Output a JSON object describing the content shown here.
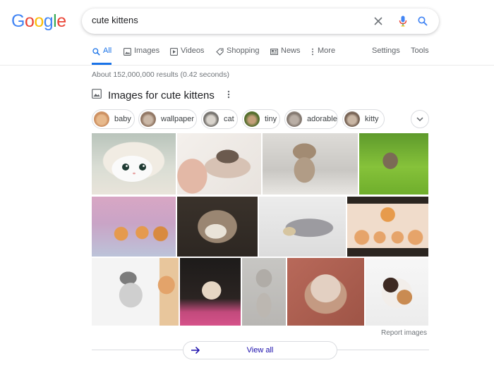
{
  "logo": {
    "letters": [
      "G",
      "o",
      "o",
      "g",
      "l",
      "e"
    ],
    "colors": [
      "#4285f4",
      "#ea4335",
      "#fbbc05",
      "#4285f4",
      "#34a853",
      "#ea4335"
    ]
  },
  "search": {
    "query": "cute kittens",
    "icons": [
      "close-icon",
      "microphone-icon",
      "search-icon"
    ]
  },
  "tabs": [
    {
      "label": "All",
      "icon": "search-icon",
      "active": true
    },
    {
      "label": "Images",
      "icon": "image-icon",
      "active": false
    },
    {
      "label": "Videos",
      "icon": "video-icon",
      "active": false
    },
    {
      "label": "Shopping",
      "icon": "tag-icon",
      "active": false
    },
    {
      "label": "News",
      "icon": "news-icon",
      "active": false
    },
    {
      "label": "More",
      "icon": "more-vert-icon",
      "active": false
    },
    {
      "label": "Settings",
      "active": false
    },
    {
      "label": "Tools",
      "active": false
    }
  ],
  "result_stats": "About 152,000,000 results (0.42 seconds)",
  "images_section": {
    "title": "Images for cute kittens",
    "chips": [
      {
        "label": "baby"
      },
      {
        "label": "wallpaper"
      },
      {
        "label": "cat"
      },
      {
        "label": "tiny"
      },
      {
        "label": "adorable"
      },
      {
        "label": "kitty"
      }
    ],
    "report_label": "Report images",
    "view_all_label": "View all"
  },
  "colors": {
    "accent": "#1a73e8",
    "link": "#1a0dab",
    "muted": "#70757a",
    "border": "#dadce0"
  }
}
